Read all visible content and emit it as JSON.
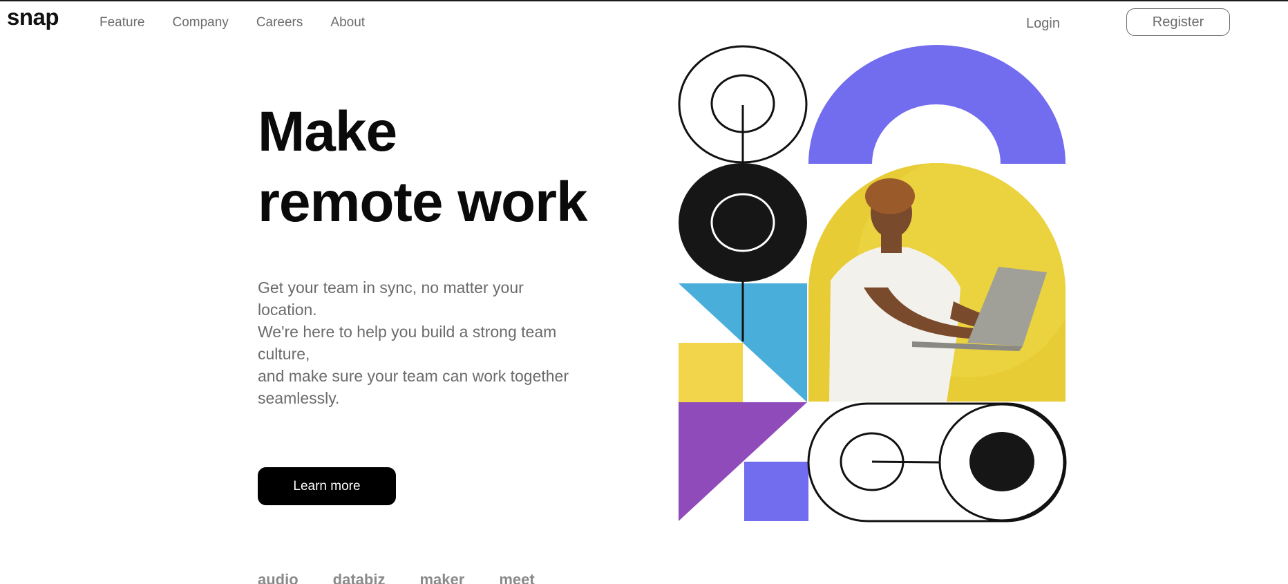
{
  "header": {
    "logo": "snap",
    "nav": [
      "Feature",
      "Company",
      "Careers",
      "About"
    ],
    "login": "Login",
    "register": "Register"
  },
  "hero": {
    "title_line1": "Make",
    "title_line2": "remote work",
    "copy": [
      "Get your team in sync, no matter your",
      "location.",
      "We're here to help you build a strong team",
      "culture,",
      "and make sure your team can work together",
      "seamlessly."
    ],
    "cta": "Learn more"
  },
  "clients": [
    "audio",
    "databiz",
    "maker",
    "meet"
  ],
  "colors": {
    "purple": "#726cee",
    "yellow": "#f2d54a",
    "blue": "#4aaedb",
    "violet": "#8f4bba",
    "dark": "#161616",
    "photo_bg": "#e8cc36"
  }
}
